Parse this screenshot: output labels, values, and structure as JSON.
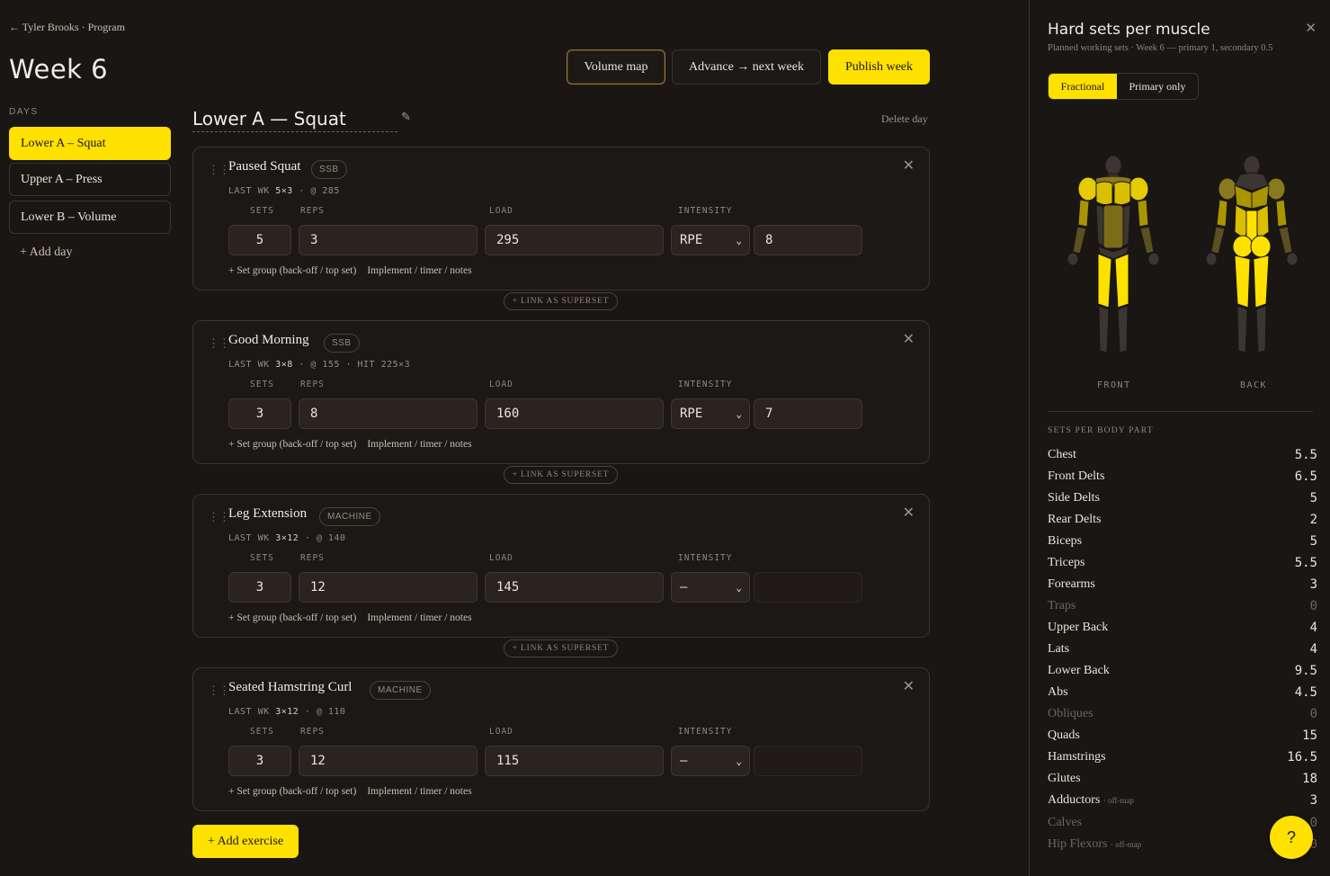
{
  "breadcrumb": "← Tyler Brooks · Program",
  "page_title": "Week 6",
  "days_label": "DAYS",
  "days": [
    {
      "label": "Lower A – Squat",
      "active": true
    },
    {
      "label": "Upper A – Press",
      "active": false
    },
    {
      "label": "Lower B – Volume",
      "active": false
    }
  ],
  "add_day": "+ Add day",
  "toolbar": {
    "volume_map": "Volume map",
    "advance": "Advance → next week",
    "publish": "Publish week"
  },
  "day_header": {
    "title": "Lower A — Squat",
    "delete": "Delete day"
  },
  "labels": {
    "sets": "SETS",
    "reps": "REPS",
    "load": "LOAD",
    "intensity": "INTENSITY",
    "set_group": "+ Set group (back-off / top set)",
    "implement": "Implement / timer / notes",
    "superset": "+ LINK AS SUPERSET"
  },
  "exercises": [
    {
      "name": "Paused Squat",
      "tag": "SSB",
      "last_prefix": "LAST WK",
      "last_sets": "5×3",
      "last_rest": "· @ 285",
      "sets": "5",
      "reps": "3",
      "load": "295",
      "intensity_type": "RPE",
      "intensity_value": "8"
    },
    {
      "name": "Good Morning",
      "tag": "SSB",
      "last_prefix": "LAST WK",
      "last_sets": "3×8",
      "last_rest": "· @ 155 · HIT 225×3",
      "sets": "3",
      "reps": "8",
      "load": "160",
      "intensity_type": "RPE",
      "intensity_value": "7"
    },
    {
      "name": "Leg Extension",
      "tag": "MACHINE",
      "last_prefix": "LAST WK",
      "last_sets": "3×12",
      "last_rest": "· @ 140",
      "sets": "3",
      "reps": "12",
      "load": "145",
      "intensity_type": "–",
      "intensity_value": ""
    },
    {
      "name": "Seated Hamstring Curl",
      "tag": "MACHINE",
      "last_prefix": "LAST WK",
      "last_sets": "3×12",
      "last_rest": "· @ 110",
      "sets": "3",
      "reps": "12",
      "load": "115",
      "intensity_type": "–",
      "intensity_value": ""
    }
  ],
  "add_exercise": "+ Add exercise",
  "panel": {
    "title": "Hard sets per muscle",
    "subtitle": "Planned working sets · Week 6 — primary 1, secondary 0.5",
    "toggle_on": "Fractional",
    "toggle_off": "Primary only",
    "front_label": "FRONT",
    "back_label": "BACK",
    "parts_label": "SETS PER BODY PART",
    "accent_color": "#ffe100",
    "parts": [
      {
        "name": "Chest",
        "value": "5.5"
      },
      {
        "name": "Front Delts",
        "value": "6.5"
      },
      {
        "name": "Side Delts",
        "value": "5"
      },
      {
        "name": "Rear Delts",
        "value": "2"
      },
      {
        "name": "Biceps",
        "value": "5"
      },
      {
        "name": "Triceps",
        "value": "5.5"
      },
      {
        "name": "Forearms",
        "value": "3"
      },
      {
        "name": "Traps",
        "value": "0"
      },
      {
        "name": "Upper Back",
        "value": "4"
      },
      {
        "name": "Lats",
        "value": "4"
      },
      {
        "name": "Lower Back",
        "value": "9.5"
      },
      {
        "name": "Abs",
        "value": "4.5"
      },
      {
        "name": "Obliques",
        "value": "0"
      },
      {
        "name": "Quads",
        "value": "15"
      },
      {
        "name": "Hamstrings",
        "value": "16.5"
      },
      {
        "name": "Glutes",
        "value": "18"
      },
      {
        "name": "Adductors",
        "note": "· off-map",
        "value": "3"
      },
      {
        "name": "Calves",
        "value": "0"
      },
      {
        "name": "Hip Flexors",
        "note": "· off-map",
        "value": "0"
      }
    ]
  },
  "help": "?"
}
